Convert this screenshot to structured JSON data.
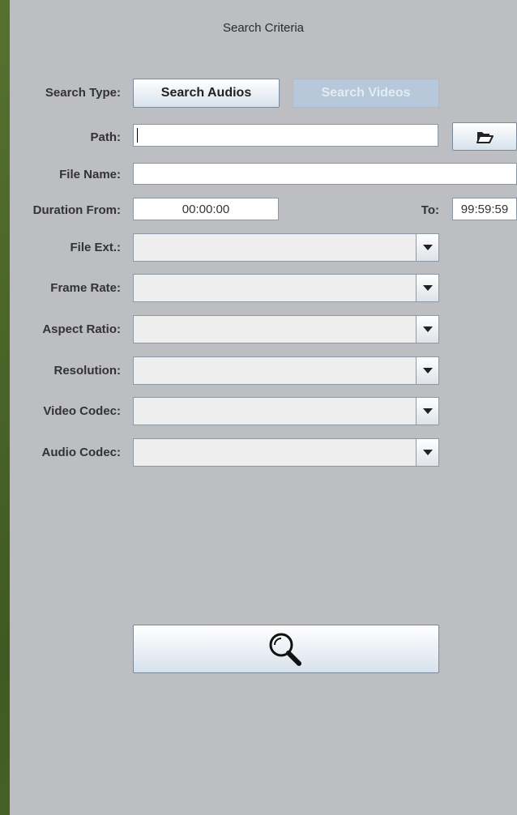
{
  "title": "Search Criteria",
  "search_type": {
    "label": "Search Type:",
    "audio_button": "Search Audios",
    "video_button": "Search Videos"
  },
  "path": {
    "label": "Path:",
    "value": ""
  },
  "file_name": {
    "label": "File Name:",
    "value": ""
  },
  "duration": {
    "from_label": "Duration From:",
    "from_value": "00:00:00",
    "to_label": "To:",
    "to_value": "99:59:59"
  },
  "combos": {
    "file_ext": {
      "label": "File Ext.:",
      "value": ""
    },
    "frame_rate": {
      "label": "Frame Rate:",
      "value": ""
    },
    "aspect_ratio": {
      "label": "Aspect Ratio:",
      "value": ""
    },
    "resolution": {
      "label": "Resolution:",
      "value": ""
    },
    "video_codec": {
      "label": "Video Codec:",
      "value": ""
    },
    "audio_codec": {
      "label": "Audio Codec:",
      "value": ""
    }
  },
  "icons": {
    "browse": "folder-open-icon",
    "search": "magnifier-icon"
  }
}
